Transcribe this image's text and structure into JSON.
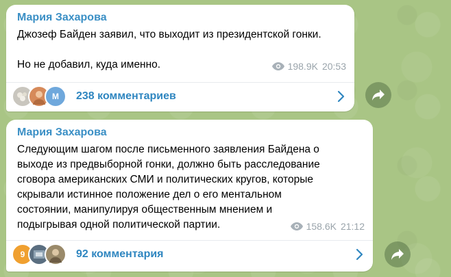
{
  "messages": [
    {
      "author": "Мария Захарова",
      "text": "Джозеф Байден заявил, что выходит из президентской гонки.\n\nНо не добавил, куда именно.",
      "views": "198.9K",
      "time": "20:53",
      "comments_label": "238 комментариев",
      "avatar_letter": "М"
    },
    {
      "author": "Мария Захарова",
      "text": "Следующим шагом после письменного заявления Байдена о\nвыходе из предвыборной гонки, должно быть  расследование\nсговора американских СМИ и политических кругов, которые\nскрывали истинное положение дел о его ментальном\nсостоянии, манипулируя общественным мнением и\nподыгрывая одной политической партии.",
      "views": "158.6K",
      "time": "21:12",
      "comments_label": "92 комментария",
      "avatar_badge": "9"
    }
  ],
  "colors": {
    "author": "#3a8fc5",
    "link": "#2f86c0",
    "meta": "#9aa4ab",
    "background": "#a9c585"
  },
  "icons": {
    "views": "eye-icon",
    "chevron": "chevron-right-icon",
    "share": "share-arrow-icon"
  }
}
